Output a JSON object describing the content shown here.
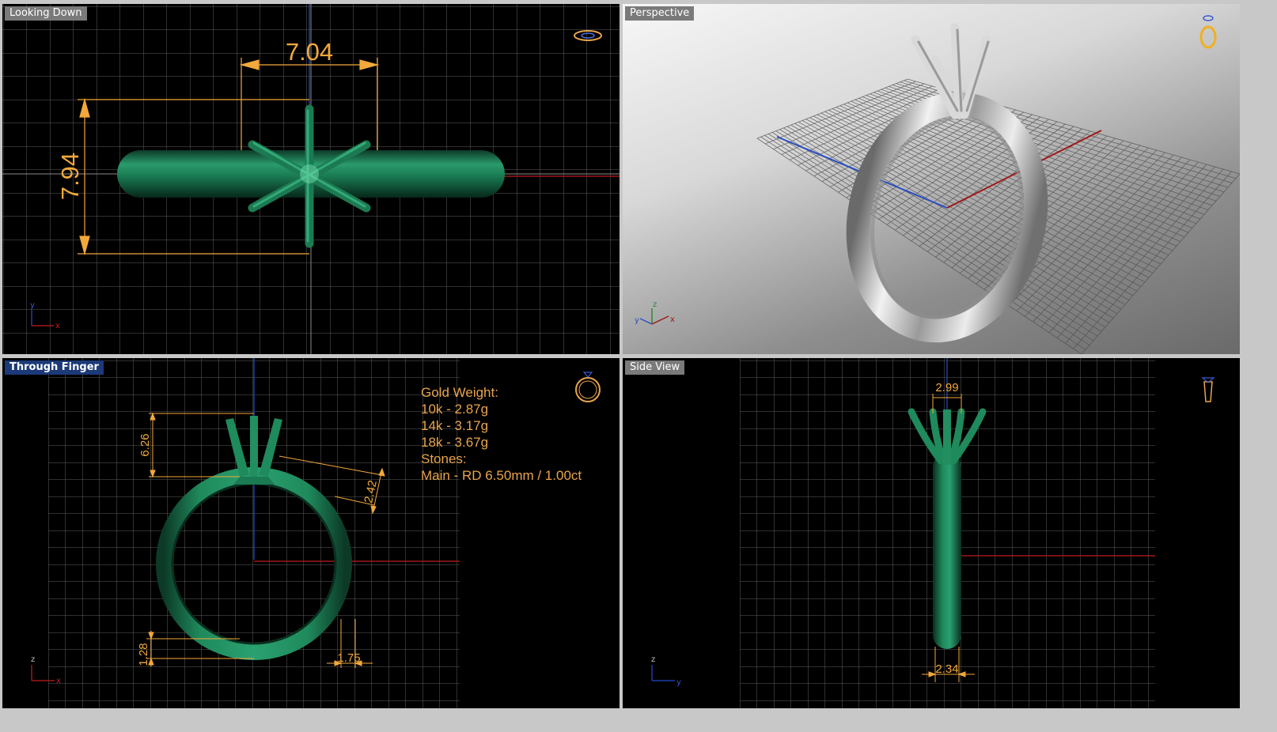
{
  "viewports": {
    "top": {
      "title": "Looking Down",
      "dim_width": "7.04",
      "dim_height": "7.94",
      "axis_y": "y",
      "axis_x": "x"
    },
    "persp": {
      "title": "Perspective",
      "axis_z": "z",
      "axis_y": "y",
      "axis_x": "x"
    },
    "front": {
      "title": "Through Finger",
      "dim_prong_height": "6.26",
      "dim_shoulder": "2.42",
      "dim_bottom_thickness": "1.28",
      "dim_bottom_width": "1.75",
      "axis_z": "z",
      "axis_x": "x",
      "info": {
        "heading": "Gold Weight:",
        "lines": [
          "10k - 2.87g",
          "14k - 3.17g",
          "18k - 3.67g"
        ],
        "stones_heading": "Stones:",
        "stones_main": "Main - RD 6.50mm / 1.00ct"
      }
    },
    "side": {
      "title": "Side View",
      "dim_top": "2.99",
      "dim_bottom": "2.34",
      "axis_z": "z",
      "axis_y": "y"
    }
  },
  "colors": {
    "ring_green": "#1f7a55",
    "dimension": "#f2a93b",
    "grid": "#6e6e6e",
    "active_title": "#1c3a78",
    "axis_x": "#a01818",
    "axis_y": "#1a3ea8"
  },
  "icons": [
    "ring-top-icon",
    "ring-perspective-icon",
    "ring-front-icon",
    "ring-side-icon"
  ]
}
